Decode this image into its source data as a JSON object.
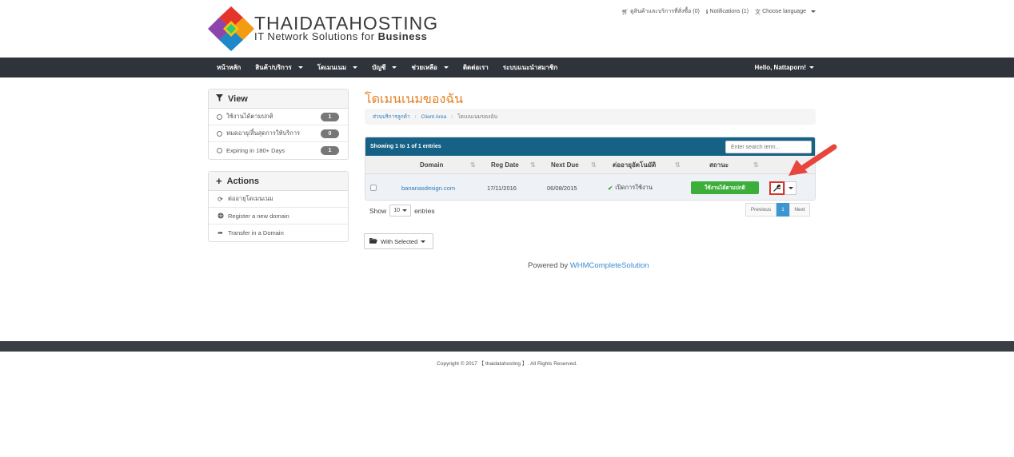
{
  "brand": {
    "title": "THAIDATAHOSTING",
    "subtitle_prefix": "IT Network Solutions for ",
    "subtitle_bold": "Business"
  },
  "toplinks": {
    "cart": "ดูสินค้าและบริการที่สั่งซื้อ (0)",
    "notifications": "Notifications (1)",
    "language": "Choose language"
  },
  "nav": {
    "items": [
      {
        "label": "หน้าหลัก",
        "caret": false
      },
      {
        "label": "สินค้า/บริการ",
        "caret": true
      },
      {
        "label": "โดเมนเนม",
        "caret": true
      },
      {
        "label": "บัญชี",
        "caret": true
      },
      {
        "label": "ช่วยเหลือ",
        "caret": true
      },
      {
        "label": "ติดต่อเรา",
        "caret": false
      },
      {
        "label": "ระบบแนะนำสมาชิก",
        "caret": false
      }
    ],
    "user": "Hello, Nattaporn!"
  },
  "view_panel": {
    "title": "View",
    "rows": [
      {
        "label": "ใช้งานได้ตามปกติ",
        "count": "1"
      },
      {
        "label": "หมดอายุ/สิ้นสุดการให้บริการ",
        "count": "0"
      },
      {
        "label": "Expiring in 180+ Days",
        "count": "1"
      }
    ]
  },
  "actions_panel": {
    "title": "Actions",
    "rows": [
      {
        "label": "ต่ออายุโดเมนเนม",
        "icon": "refresh-icon"
      },
      {
        "label": "Register a new domain",
        "icon": "globe-icon"
      },
      {
        "label": "Transfer in a Domain",
        "icon": "share-icon"
      }
    ]
  },
  "main": {
    "title": "โดเมนเนมของฉัน",
    "breadcrumb": [
      "ส่วนบริการลูกค้า",
      "Client Area",
      "โดเมนเนมของฉัน"
    ]
  },
  "table": {
    "info": "Showing 1 to 1 of 1 entries",
    "search_placeholder": "Enter search term...",
    "columns": [
      "Domain",
      "Reg Date",
      "Next Due",
      "ต่ออายุอัตโนมัติ",
      "สถานะ"
    ],
    "rows": [
      {
        "domain": "bananasdesign.com",
        "reg_date": "17/11/2016",
        "next_due": "06/08/2015",
        "auto_renew": "เปิดการใช้งาน",
        "status": "ใช้งานได้ตามปกติ"
      }
    ]
  },
  "length": {
    "show": "Show",
    "value": "10",
    "entries": "entries"
  },
  "pager": {
    "previous": "Previous",
    "current": "1",
    "next": "Next"
  },
  "with_selected": "With Selected",
  "powered": {
    "prefix": "Powered by ",
    "link": "WHMCompleteSolution"
  },
  "copyright": "Copyright © 2017 【 thaidatahosting 】. All Rights Reserved.",
  "colors": {
    "navbar": "#2f333a",
    "table_header": "#166186",
    "title": "#e67e22",
    "status_green": "#3cae3a",
    "highlight_red": "#d9372a"
  }
}
